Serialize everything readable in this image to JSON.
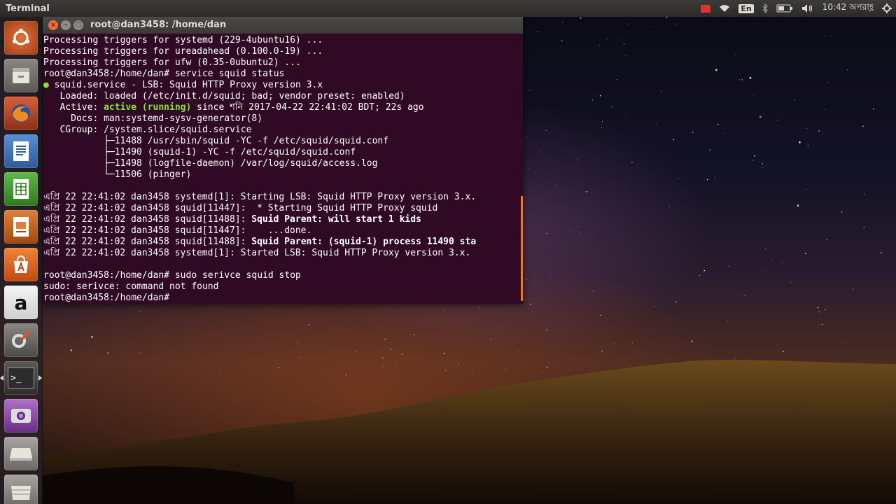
{
  "top_panel": {
    "app_title": "Terminal",
    "lang_indicator": "En",
    "clock": "10:42 অপরাহ্ণ",
    "icons": [
      "record-icon",
      "wifi-icon",
      "keyboard-layout-icon",
      "bluetooth-icon",
      "battery-icon",
      "volume-icon",
      "settings-gear-icon"
    ]
  },
  "launcher": {
    "items": [
      {
        "name": "ubuntu-dash-icon"
      },
      {
        "name": "files-icon"
      },
      {
        "name": "firefox-icon"
      },
      {
        "name": "writer-icon"
      },
      {
        "name": "calc-icon"
      },
      {
        "name": "impress-icon"
      },
      {
        "name": "software-center-icon"
      },
      {
        "name": "amazon-icon",
        "glyph": "a"
      },
      {
        "name": "system-settings-icon"
      },
      {
        "name": "terminal-icon",
        "glyph": ">_"
      },
      {
        "name": "screen-recorder-icon"
      },
      {
        "name": "drive-icon"
      },
      {
        "name": "trash-icon"
      }
    ]
  },
  "window": {
    "title": "root@dan3458: /home/dan",
    "controls": {
      "close": "×",
      "minimize": "–",
      "maximize": "□"
    }
  },
  "terminal": {
    "lines": [
      [
        {
          "t": "Processing triggers for systemd (229-4ubuntu16) ..."
        }
      ],
      [
        {
          "t": "Processing triggers for ureadahead (0.100.0-19) ..."
        }
      ],
      [
        {
          "t": "Processing triggers for ufw (0.35-0ubuntu2) ..."
        }
      ],
      [
        {
          "t": "root@dan3458:/home/dan# service squid status"
        }
      ],
      [
        {
          "t": "●",
          "s": "dot"
        },
        {
          "t": " squid.service - LSB: Squid HTTP Proxy version 3.x"
        }
      ],
      [
        {
          "t": "   Loaded: loaded (/etc/init.d/squid; bad; vendor preset: enabled)"
        }
      ],
      [
        {
          "t": "   Active: "
        },
        {
          "t": "active (running)",
          "s": "green"
        },
        {
          "t": " since শনি 2017-04-22 22:41:02 BDT; 22s ago"
        }
      ],
      [
        {
          "t": "     Docs: man:systemd-sysv-generator(8)"
        }
      ],
      [
        {
          "t": "   CGroup: /system.slice/squid.service"
        }
      ],
      [
        {
          "t": "           ├─11488 /usr/sbin/squid -YC -f /etc/squid/squid.conf"
        }
      ],
      [
        {
          "t": "           ├─11490 (squid-1) -YC -f /etc/squid/squid.conf"
        }
      ],
      [
        {
          "t": "           ├─11498 (logfile-daemon) /var/log/squid/access.log"
        }
      ],
      [
        {
          "t": "           └─11506 (pinger)"
        }
      ],
      [
        {
          "t": ""
        }
      ],
      [
        {
          "t": "এপ্রি 22 22:41:02 dan3458 systemd[1]: Starting LSB: Squid HTTP Proxy version 3.x."
        }
      ],
      [
        {
          "t": "এপ্রি 22 22:41:02 dan3458 squid[11447]:  * Starting Squid HTTP Proxy squid"
        }
      ],
      [
        {
          "t": "এপ্রি 22 22:41:02 dan3458 squid[11488]: "
        },
        {
          "t": "Squid Parent: will start 1 kids",
          "s": "bold"
        }
      ],
      [
        {
          "t": "এপ্রি 22 22:41:02 dan3458 squid[11447]:    ...done."
        }
      ],
      [
        {
          "t": "এপ্রি 22 22:41:02 dan3458 squid[11488]: "
        },
        {
          "t": "Squid Parent: (squid-1) process 11490 sta",
          "s": "bold"
        }
      ],
      [
        {
          "t": "এপ্রি 22 22:41:02 dan3458 systemd[1]: Started LSB: Squid HTTP Proxy version 3.x."
        }
      ],
      [
        {
          "t": ""
        }
      ],
      [
        {
          "t": "root@dan3458:/home/dan# sudo serivce squid stop"
        }
      ],
      [
        {
          "t": "sudo: serivce: command not found"
        }
      ],
      [
        {
          "t": "root@dan3458:/home/dan# "
        }
      ]
    ]
  }
}
